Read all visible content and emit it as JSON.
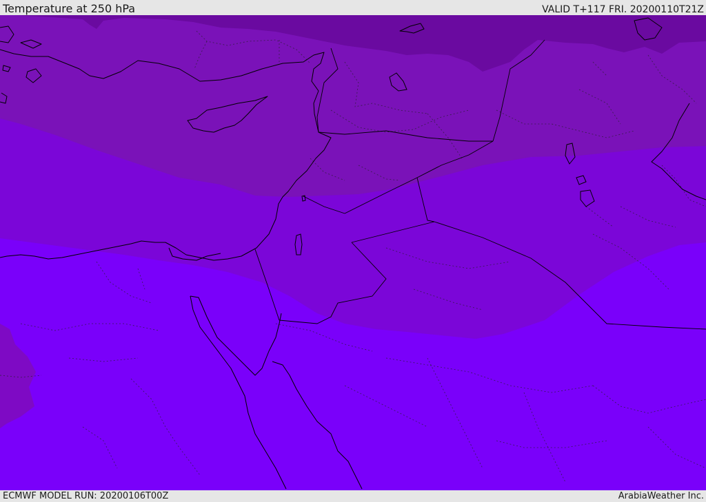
{
  "header": {
    "title": "Temperature at 250 hPa",
    "valid": "VALID T+117 FRI. 20200110T21Z"
  },
  "footer": {
    "model_run": "ECMWF MODEL RUN: 20200106T00Z",
    "credit": "ArabiaWeather Inc."
  },
  "colors": {
    "band_coldest": "#6a0aa0",
    "band_cold": "#7a12b8",
    "band_mid": "#7b06d8",
    "band_warm": "#7a00fa",
    "band_west_patch": "#7e0ac4",
    "coastline": "#000000",
    "header_bg": "#e6e6e6"
  }
}
